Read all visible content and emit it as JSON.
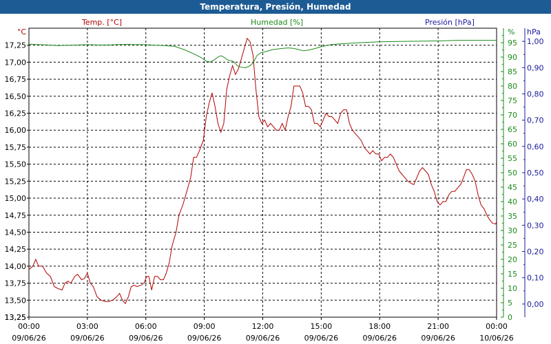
{
  "window": {
    "title": "Temperatura, Presión, Humedad"
  },
  "colors": {
    "title_bar": "#1d5b94",
    "temperature": "#b00000",
    "humidity": "#1a8a1a",
    "pressure": "#1a1a9c",
    "grid": "#000000",
    "axis_text": "#000000"
  },
  "chart_data": {
    "type": "line",
    "grid": true,
    "legend": "top, above plot",
    "x_axis": {
      "ticks": [
        {
          "time": "00:00",
          "date": "09/06/26",
          "hour": 0
        },
        {
          "time": "03:00",
          "date": "09/06/26",
          "hour": 3
        },
        {
          "time": "06:00",
          "date": "09/06/26",
          "hour": 6
        },
        {
          "time": "09:00",
          "date": "09/06/26",
          "hour": 9
        },
        {
          "time": "12:00",
          "date": "09/06/26",
          "hour": 12
        },
        {
          "time": "15:00",
          "date": "09/06/26",
          "hour": 15
        },
        {
          "time": "18:00",
          "date": "09/06/26",
          "hour": 18
        },
        {
          "time": "21:00",
          "date": "09/06/26",
          "hour": 21
        },
        {
          "time": "00:00",
          "date": "10/06/26",
          "hour": 24
        }
      ],
      "range_hours": [
        0,
        24
      ]
    },
    "y_axes": {
      "temperature": {
        "unit": "°C",
        "range": [
          13.25,
          17.5
        ],
        "ticks": [
          "13,25",
          "13,50",
          "13,75",
          "14,00",
          "14,25",
          "14,50",
          "14,75",
          "15,00",
          "15,25",
          "15,50",
          "15,75",
          "16,00",
          "16,25",
          "16,50",
          "16,75",
          "17,00",
          "17,25"
        ]
      },
      "humidity": {
        "unit": "%",
        "range": [
          0,
          100
        ],
        "ticks": [
          "0",
          "5",
          "10",
          "15",
          "20",
          "25",
          "30",
          "35",
          "40",
          "45",
          "50",
          "55",
          "60",
          "65",
          "70",
          "75",
          "80",
          "85",
          "90",
          "95"
        ]
      },
      "pressure": {
        "unit": "hPa",
        "range": [
          -0.05,
          1.05
        ],
        "ticks": [
          "0,00",
          "0,10",
          "0,20",
          "0,30",
          "0,40",
          "0,50",
          "0,60",
          "0,70",
          "0,80",
          "0,90",
          "1,00"
        ]
      }
    },
    "series": [
      {
        "name": "Temp. [°C]",
        "key": "temperature",
        "axis": "temperature",
        "points": [
          [
            0.0,
            13.95
          ],
          [
            0.2,
            14.0
          ],
          [
            0.35,
            14.1
          ],
          [
            0.5,
            14.0
          ],
          [
            0.7,
            14.0
          ],
          [
            0.9,
            13.9
          ],
          [
            1.1,
            13.85
          ],
          [
            1.3,
            13.7
          ],
          [
            1.5,
            13.67
          ],
          [
            1.7,
            13.65
          ],
          [
            1.85,
            13.75
          ],
          [
            2.0,
            13.78
          ],
          [
            2.15,
            13.75
          ],
          [
            2.35,
            13.85
          ],
          [
            2.5,
            13.88
          ],
          [
            2.7,
            13.8
          ],
          [
            2.85,
            13.82
          ],
          [
            3.0,
            13.9
          ],
          [
            3.15,
            13.75
          ],
          [
            3.3,
            13.7
          ],
          [
            3.5,
            13.55
          ],
          [
            3.7,
            13.5
          ],
          [
            3.9,
            13.48
          ],
          [
            4.1,
            13.48
          ],
          [
            4.3,
            13.5
          ],
          [
            4.5,
            13.55
          ],
          [
            4.65,
            13.6
          ],
          [
            4.8,
            13.5
          ],
          [
            4.95,
            13.45
          ],
          [
            5.1,
            13.55
          ],
          [
            5.25,
            13.7
          ],
          [
            5.4,
            13.72
          ],
          [
            5.55,
            13.7
          ],
          [
            5.75,
            13.72
          ],
          [
            5.9,
            13.75
          ],
          [
            6.05,
            13.85
          ],
          [
            6.15,
            13.85
          ],
          [
            6.3,
            13.65
          ],
          [
            6.45,
            13.85
          ],
          [
            6.6,
            13.85
          ],
          [
            6.75,
            13.8
          ],
          [
            6.9,
            13.8
          ],
          [
            7.05,
            13.9
          ],
          [
            7.2,
            14.05
          ],
          [
            7.35,
            14.3
          ],
          [
            7.55,
            14.5
          ],
          [
            7.7,
            14.75
          ],
          [
            7.9,
            14.9
          ],
          [
            8.1,
            15.1
          ],
          [
            8.3,
            15.3
          ],
          [
            8.45,
            15.6
          ],
          [
            8.6,
            15.6
          ],
          [
            8.75,
            15.7
          ],
          [
            8.95,
            15.85
          ],
          [
            9.1,
            16.2
          ],
          [
            9.25,
            16.4
          ],
          [
            9.4,
            16.55
          ],
          [
            9.55,
            16.35
          ],
          [
            9.7,
            16.1
          ],
          [
            9.85,
            15.97
          ],
          [
            10.0,
            16.1
          ],
          [
            10.15,
            16.6
          ],
          [
            10.3,
            16.8
          ],
          [
            10.45,
            16.95
          ],
          [
            10.6,
            16.82
          ],
          [
            10.75,
            16.9
          ],
          [
            10.9,
            17.05
          ],
          [
            11.05,
            17.2
          ],
          [
            11.2,
            17.35
          ],
          [
            11.35,
            17.3
          ],
          [
            11.5,
            17.1
          ],
          [
            11.65,
            16.6
          ],
          [
            11.8,
            16.2
          ],
          [
            11.95,
            16.1
          ],
          [
            12.1,
            16.15
          ],
          [
            12.25,
            16.05
          ],
          [
            12.4,
            16.1
          ],
          [
            12.55,
            16.05
          ],
          [
            12.7,
            16.0
          ],
          [
            12.85,
            16.0
          ],
          [
            13.0,
            16.1
          ],
          [
            13.15,
            16.0
          ],
          [
            13.3,
            16.2
          ],
          [
            13.45,
            16.35
          ],
          [
            13.6,
            16.65
          ],
          [
            13.75,
            16.65
          ],
          [
            13.9,
            16.65
          ],
          [
            14.05,
            16.55
          ],
          [
            14.2,
            16.35
          ],
          [
            14.35,
            16.35
          ],
          [
            14.5,
            16.3
          ],
          [
            14.65,
            16.1
          ],
          [
            14.8,
            16.1
          ],
          [
            14.95,
            16.05
          ],
          [
            15.1,
            16.15
          ],
          [
            15.25,
            16.25
          ],
          [
            15.4,
            16.2
          ],
          [
            15.55,
            16.2
          ],
          [
            15.7,
            16.15
          ],
          [
            15.85,
            16.1
          ],
          [
            16.0,
            16.25
          ],
          [
            16.15,
            16.3
          ],
          [
            16.3,
            16.3
          ],
          [
            16.45,
            16.1
          ],
          [
            16.6,
            16.0
          ],
          [
            16.75,
            15.95
          ],
          [
            16.9,
            15.9
          ],
          [
            17.05,
            15.85
          ],
          [
            17.2,
            15.75
          ],
          [
            17.35,
            15.7
          ],
          [
            17.5,
            15.65
          ],
          [
            17.65,
            15.7
          ],
          [
            17.8,
            15.65
          ],
          [
            17.95,
            15.65
          ],
          [
            18.1,
            15.55
          ],
          [
            18.25,
            15.6
          ],
          [
            18.4,
            15.6
          ],
          [
            18.55,
            15.65
          ],
          [
            18.7,
            15.6
          ],
          [
            18.85,
            15.5
          ],
          [
            19.0,
            15.4
          ],
          [
            19.15,
            15.35
          ],
          [
            19.3,
            15.3
          ],
          [
            19.45,
            15.25
          ],
          [
            19.6,
            15.22
          ],
          [
            19.75,
            15.2
          ],
          [
            19.9,
            15.3
          ],
          [
            20.05,
            15.4
          ],
          [
            20.2,
            15.45
          ],
          [
            20.35,
            15.4
          ],
          [
            20.5,
            15.35
          ],
          [
            20.65,
            15.2
          ],
          [
            20.8,
            15.1
          ],
          [
            20.95,
            14.95
          ],
          [
            21.1,
            14.9
          ],
          [
            21.25,
            14.95
          ],
          [
            21.4,
            14.95
          ],
          [
            21.55,
            15.05
          ],
          [
            21.7,
            15.1
          ],
          [
            21.85,
            15.1
          ],
          [
            22.0,
            15.15
          ],
          [
            22.15,
            15.2
          ],
          [
            22.3,
            15.3
          ],
          [
            22.45,
            15.42
          ],
          [
            22.6,
            15.42
          ],
          [
            22.75,
            15.35
          ],
          [
            22.9,
            15.25
          ],
          [
            23.05,
            15.05
          ],
          [
            23.2,
            14.9
          ],
          [
            23.35,
            14.85
          ],
          [
            23.5,
            14.75
          ],
          [
            23.65,
            14.68
          ],
          [
            23.8,
            14.63
          ],
          [
            23.95,
            14.62
          ],
          [
            24.0,
            14.65
          ]
        ]
      },
      {
        "name": "Humedad [%]",
        "key": "humidity",
        "axis": "humidity",
        "points": [
          [
            0.0,
            94.5
          ],
          [
            0.5,
            94.3
          ],
          [
            1.0,
            94.2
          ],
          [
            1.5,
            94.0
          ],
          [
            2.0,
            94.1
          ],
          [
            2.5,
            94.2
          ],
          [
            3.0,
            94.3
          ],
          [
            3.5,
            94.2
          ],
          [
            4.0,
            94.2
          ],
          [
            4.5,
            94.3
          ],
          [
            5.0,
            94.4
          ],
          [
            5.5,
            94.3
          ],
          [
            6.0,
            94.3
          ],
          [
            6.5,
            94.1
          ],
          [
            7.0,
            94.0
          ],
          [
            7.5,
            93.7
          ],
          [
            8.0,
            92.5
          ],
          [
            8.5,
            91.0
          ],
          [
            8.8,
            90.0
          ],
          [
            9.1,
            88.6
          ],
          [
            9.3,
            88.3
          ],
          [
            9.5,
            89.0
          ],
          [
            9.7,
            90.0
          ],
          [
            9.85,
            90.5
          ],
          [
            10.0,
            90.0
          ],
          [
            10.2,
            89.0
          ],
          [
            10.5,
            88.5
          ],
          [
            10.7,
            87.0
          ],
          [
            10.9,
            86.5
          ],
          [
            11.1,
            86.3
          ],
          [
            11.3,
            86.8
          ],
          [
            11.5,
            88.0
          ],
          [
            11.7,
            90.5
          ],
          [
            11.9,
            91.5
          ],
          [
            12.2,
            92.0
          ],
          [
            12.5,
            92.6
          ],
          [
            13.0,
            93.0
          ],
          [
            13.3,
            93.2
          ],
          [
            13.6,
            93.0
          ],
          [
            13.9,
            92.5
          ],
          [
            14.1,
            92.2
          ],
          [
            14.4,
            92.5
          ],
          [
            14.7,
            93.0
          ],
          [
            15.0,
            93.6
          ],
          [
            15.5,
            94.3
          ],
          [
            16.0,
            94.6
          ],
          [
            17.0,
            95.0
          ],
          [
            18.0,
            95.3
          ],
          [
            19.0,
            95.4
          ],
          [
            20.0,
            95.5
          ],
          [
            21.0,
            95.6
          ],
          [
            22.0,
            95.8
          ],
          [
            23.0,
            95.8
          ],
          [
            24.0,
            95.8
          ]
        ]
      }
    ]
  }
}
